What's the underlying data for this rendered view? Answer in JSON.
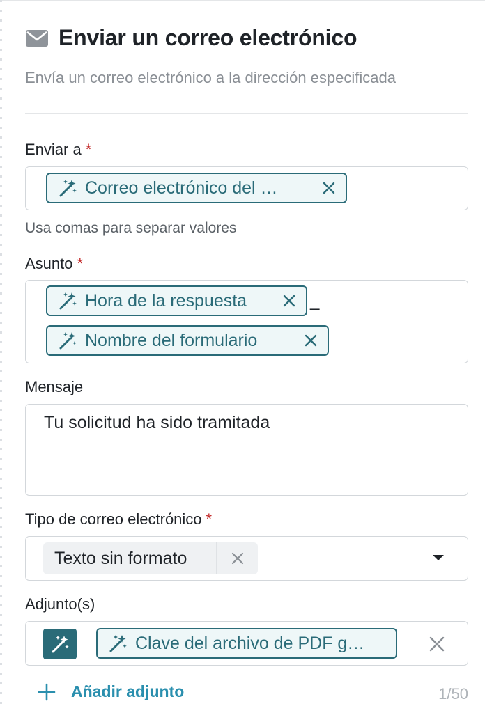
{
  "header": {
    "title": "Enviar un correo electrónico",
    "subtitle": "Envía un correo electrónico a la dirección especificada",
    "icon": "mail-icon"
  },
  "fields": {
    "to": {
      "label": "Enviar a",
      "required_mark": "*",
      "chips": [
        "Correo electrónico del …"
      ],
      "hint": "Usa comas para separar valores"
    },
    "subject": {
      "label": "Asunto",
      "required_mark": "*",
      "chips": [
        "Hora de la respuesta",
        "Nombre del formulario"
      ],
      "separator_text": "_"
    },
    "message": {
      "label": "Mensaje",
      "value": "Tu solicitud ha sido tramitada"
    },
    "email_type": {
      "label": "Tipo de correo electrónico",
      "required_mark": "*",
      "selected": "Texto sin formato"
    },
    "attachments": {
      "label": "Adjunto(s)",
      "chips": [
        "Clave del archivo de PDF g…"
      ],
      "add_label": "Añadir adjunto",
      "count": "1/50"
    }
  },
  "colors": {
    "accent": "#2a6b78",
    "link": "#2a8fae",
    "required": "#c42b2b",
    "muted": "#8a8f95"
  }
}
